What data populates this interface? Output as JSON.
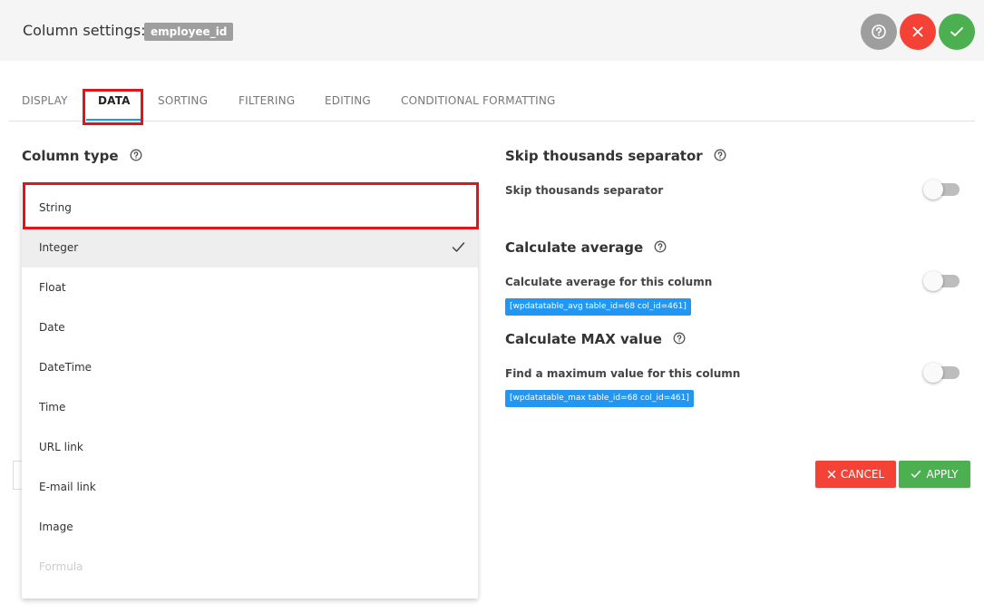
{
  "header": {
    "title": "Column settings:",
    "badge": "employee_id",
    "buttons": [
      {
        "name": "help",
        "icon": "question-circle-icon",
        "color": "#9e9e9e"
      },
      {
        "name": "close",
        "icon": "close-icon",
        "color": "#f44336"
      },
      {
        "name": "confirm",
        "icon": "check-icon",
        "color": "#4caf50"
      }
    ]
  },
  "tabs": [
    {
      "label": "DISPLAY",
      "active": false
    },
    {
      "label": "DATA",
      "active": true
    },
    {
      "label": "SORTING",
      "active": false
    },
    {
      "label": "FILTERING",
      "active": false
    },
    {
      "label": "EDITING",
      "active": false
    },
    {
      "label": "CONDITIONAL FORMATTING",
      "active": false
    }
  ],
  "column_type": {
    "title": "Column type",
    "current_value": "String",
    "options": [
      {
        "label": "Integer",
        "selected": true,
        "disabled": false
      },
      {
        "label": "Float",
        "selected": false,
        "disabled": false
      },
      {
        "label": "Date",
        "selected": false,
        "disabled": false
      },
      {
        "label": "DateTime",
        "selected": false,
        "disabled": false
      },
      {
        "label": "Time",
        "selected": false,
        "disabled": false
      },
      {
        "label": "URL link",
        "selected": false,
        "disabled": false
      },
      {
        "label": "E-mail link",
        "selected": false,
        "disabled": false
      },
      {
        "label": "Image",
        "selected": false,
        "disabled": false
      },
      {
        "label": "Formula",
        "selected": false,
        "disabled": true
      }
    ]
  },
  "skip_thousands": {
    "title": "Skip thousands separator",
    "label": "Skip thousands separator",
    "enabled": false
  },
  "calc_average": {
    "title": "Calculate average",
    "label": "Calculate average for this column",
    "enabled": false,
    "shortcode": "[wpdatatable_avg table_id=68 col_id=461]"
  },
  "calc_max": {
    "title": "Calculate MAX value",
    "label": "Find a maximum value for this column",
    "enabled": false,
    "shortcode": "[wpdatatable_max table_id=68 col_id=461]"
  },
  "actions": {
    "cancel_label": "CANCEL",
    "apply_label": "APPLY"
  },
  "colors": {
    "accent": "#2196f3",
    "danger": "#f44336",
    "success": "#4caf50",
    "highlight": "#e0141b"
  }
}
